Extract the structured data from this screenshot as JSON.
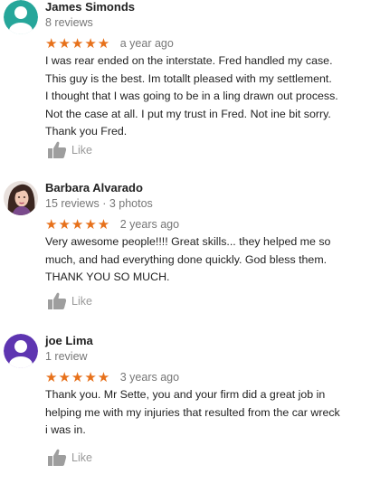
{
  "colors": {
    "star": "#e7711b",
    "meta": "#777777",
    "like": "#999999"
  },
  "reviews": [
    {
      "name": "James Simonds",
      "meta": "8 reviews",
      "rating": 5,
      "stars": "★★★★★",
      "age": "a year ago",
      "text_lines": [
        "I was rear ended on the interstate. Fred handled my case.",
        "This guy is the best. Im totallt pleased with my settlement.",
        "I thought that I was going to be in a ling drawn out process.",
        "Not the case at all. I put my trust in Fred. Not ine bit sorry.",
        "Thank  you Fred."
      ],
      "like_label": "Like",
      "avatar_color": "#26a69a"
    },
    {
      "name": "Barbara Alvarado",
      "meta": "15 reviews · 3 photos",
      "rating": 5,
      "stars": "★★★★★",
      "age": "2 years ago",
      "text_lines": [
        "Very awesome people!!!!  Great skills... they helped me so",
        "much, and had everything  done quickly. God bless them.",
        "THANK YOU SO MUCH."
      ],
      "like_label": "Like",
      "avatar_color": "#6b4a3a"
    },
    {
      "name": "joe Lima",
      "meta": "1 review",
      "rating": 5,
      "stars": "★★★★★",
      "age": "3 years ago",
      "text_lines": [
        "Thank  you. Mr Sette, you and your firm did a great job in",
        "helping  me with my injuries that resulted from the car wreck",
        "i was in."
      ],
      "like_label": "Like",
      "avatar_color": "#5e35b1"
    }
  ]
}
